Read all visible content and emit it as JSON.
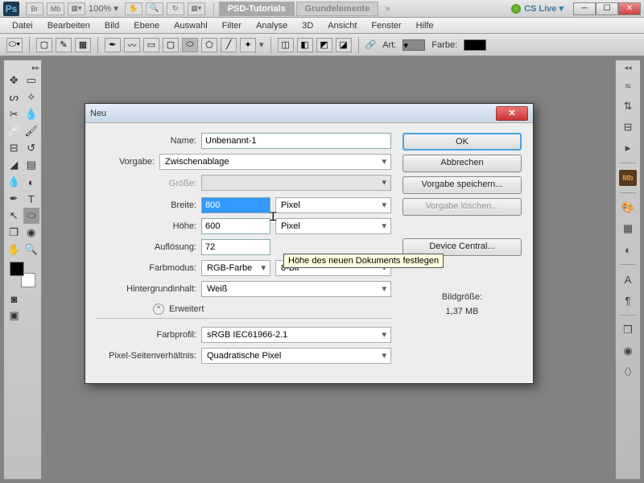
{
  "app": {
    "logo": "Ps"
  },
  "top": {
    "zoom": "100%",
    "tabs": [
      {
        "label": "PSD-Tutorials",
        "active": true
      },
      {
        "label": "Grundelemente",
        "active": false
      }
    ],
    "cslive": "CS Live"
  },
  "menu": [
    "Datei",
    "Bearbeiten",
    "Bild",
    "Ebene",
    "Auswahl",
    "Filter",
    "Analyse",
    "3D",
    "Ansicht",
    "Fenster",
    "Hilfe"
  ],
  "opt": {
    "art": "Art:",
    "farbe": "Farbe:"
  },
  "dialog": {
    "title": "Neu",
    "name_lbl": "Name:",
    "name_val": "Unbenannt-1",
    "preset_lbl": "Vorgabe:",
    "preset_val": "Zwischenablage",
    "size_lbl": "Größe:",
    "width_lbl": "Breite:",
    "width_val": "800",
    "width_unit": "Pixel",
    "height_lbl": "Höhe:",
    "height_val": "600",
    "height_unit": "Pixel",
    "res_lbl": "Auflösung:",
    "res_val": "72",
    "mode_lbl": "Farbmodus:",
    "mode_val": "RGB-Farbe",
    "depth_val": "8-Bit",
    "bginhalt_lbl": "Hintergrundinhalt:",
    "bginhalt_val": "Weiß",
    "erweitert": "Erweitert",
    "profil_lbl": "Farbprofil:",
    "profil_val": "sRGB IEC61966-2.1",
    "pixelar_lbl": "Pixel-Seitenverhältnis:",
    "pixelar_val": "Quadratische Pixel",
    "ok": "OK",
    "cancel": "Abbrechen",
    "save": "Vorgabe speichern...",
    "del": "Vorgabe löschen...",
    "device": "Device Central...",
    "filesize_lbl": "Bildgröße:",
    "filesize_val": "1,37 MB",
    "tooltip": "Höhe des neuen Dokuments festlegen"
  }
}
